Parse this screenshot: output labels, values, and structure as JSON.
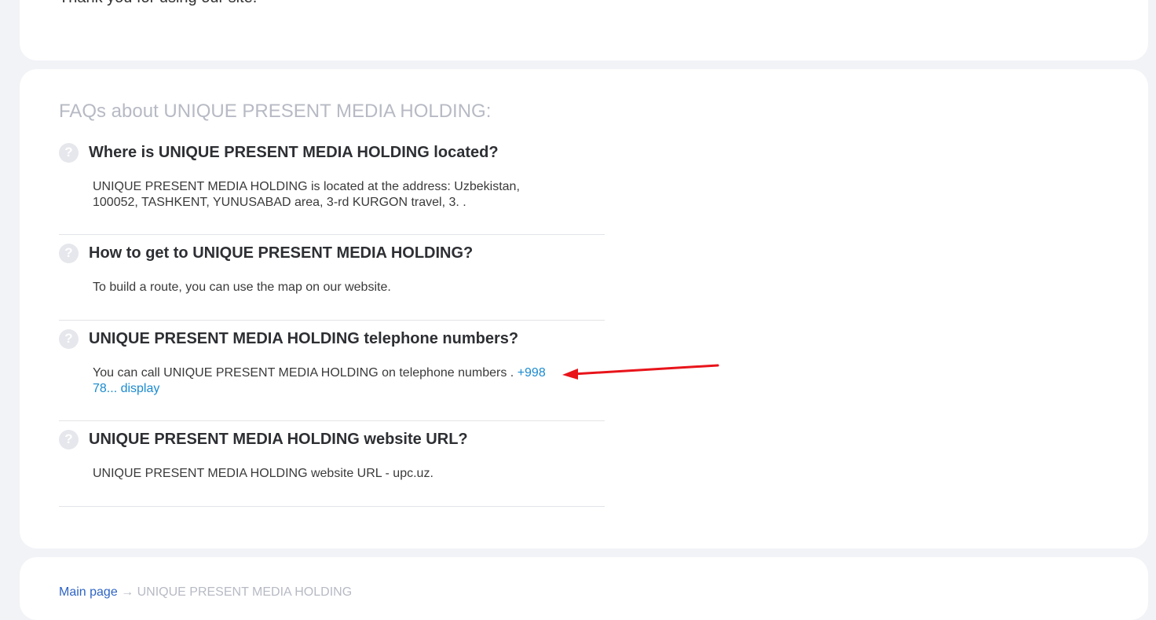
{
  "top_card": {
    "thanks_text": "Thank you for using our site."
  },
  "faq": {
    "title": "FAQs about UNIQUE PRESENT MEDIA HOLDING:",
    "question_icon_glyph": "?",
    "items": [
      {
        "question": "Where is UNIQUE PRESENT MEDIA HOLDING located?",
        "answer": "UNIQUE PRESENT MEDIA HOLDING is located at the address: Uzbekistan, 100052, TASHKENT, YUNUSABAD area, 3-rd KURGON travel, 3. ."
      },
      {
        "question": "How to get to UNIQUE PRESENT MEDIA HOLDING?",
        "answer": "To build a route, you can use the map on our website."
      },
      {
        "question": "UNIQUE PRESENT MEDIA HOLDING telephone numbers?",
        "answer": "You can call UNIQUE PRESENT MEDIA HOLDING on telephone numbers . ",
        "phone_link": "+998 78... display"
      },
      {
        "question": "UNIQUE PRESENT MEDIA HOLDING website URL?",
        "answer": "UNIQUE PRESENT MEDIA HOLDING website URL - upc.uz."
      }
    ]
  },
  "bottom_card": {
    "crumb_link": "Main page",
    "crumb_separator": " → ",
    "crumb_current": "UNIQUE PRESENT MEDIA HOLDING"
  },
  "colors": {
    "page_bg": "#f2f3f7",
    "link": "#1b8bd0",
    "annotation_arrow": "#e8141a"
  }
}
